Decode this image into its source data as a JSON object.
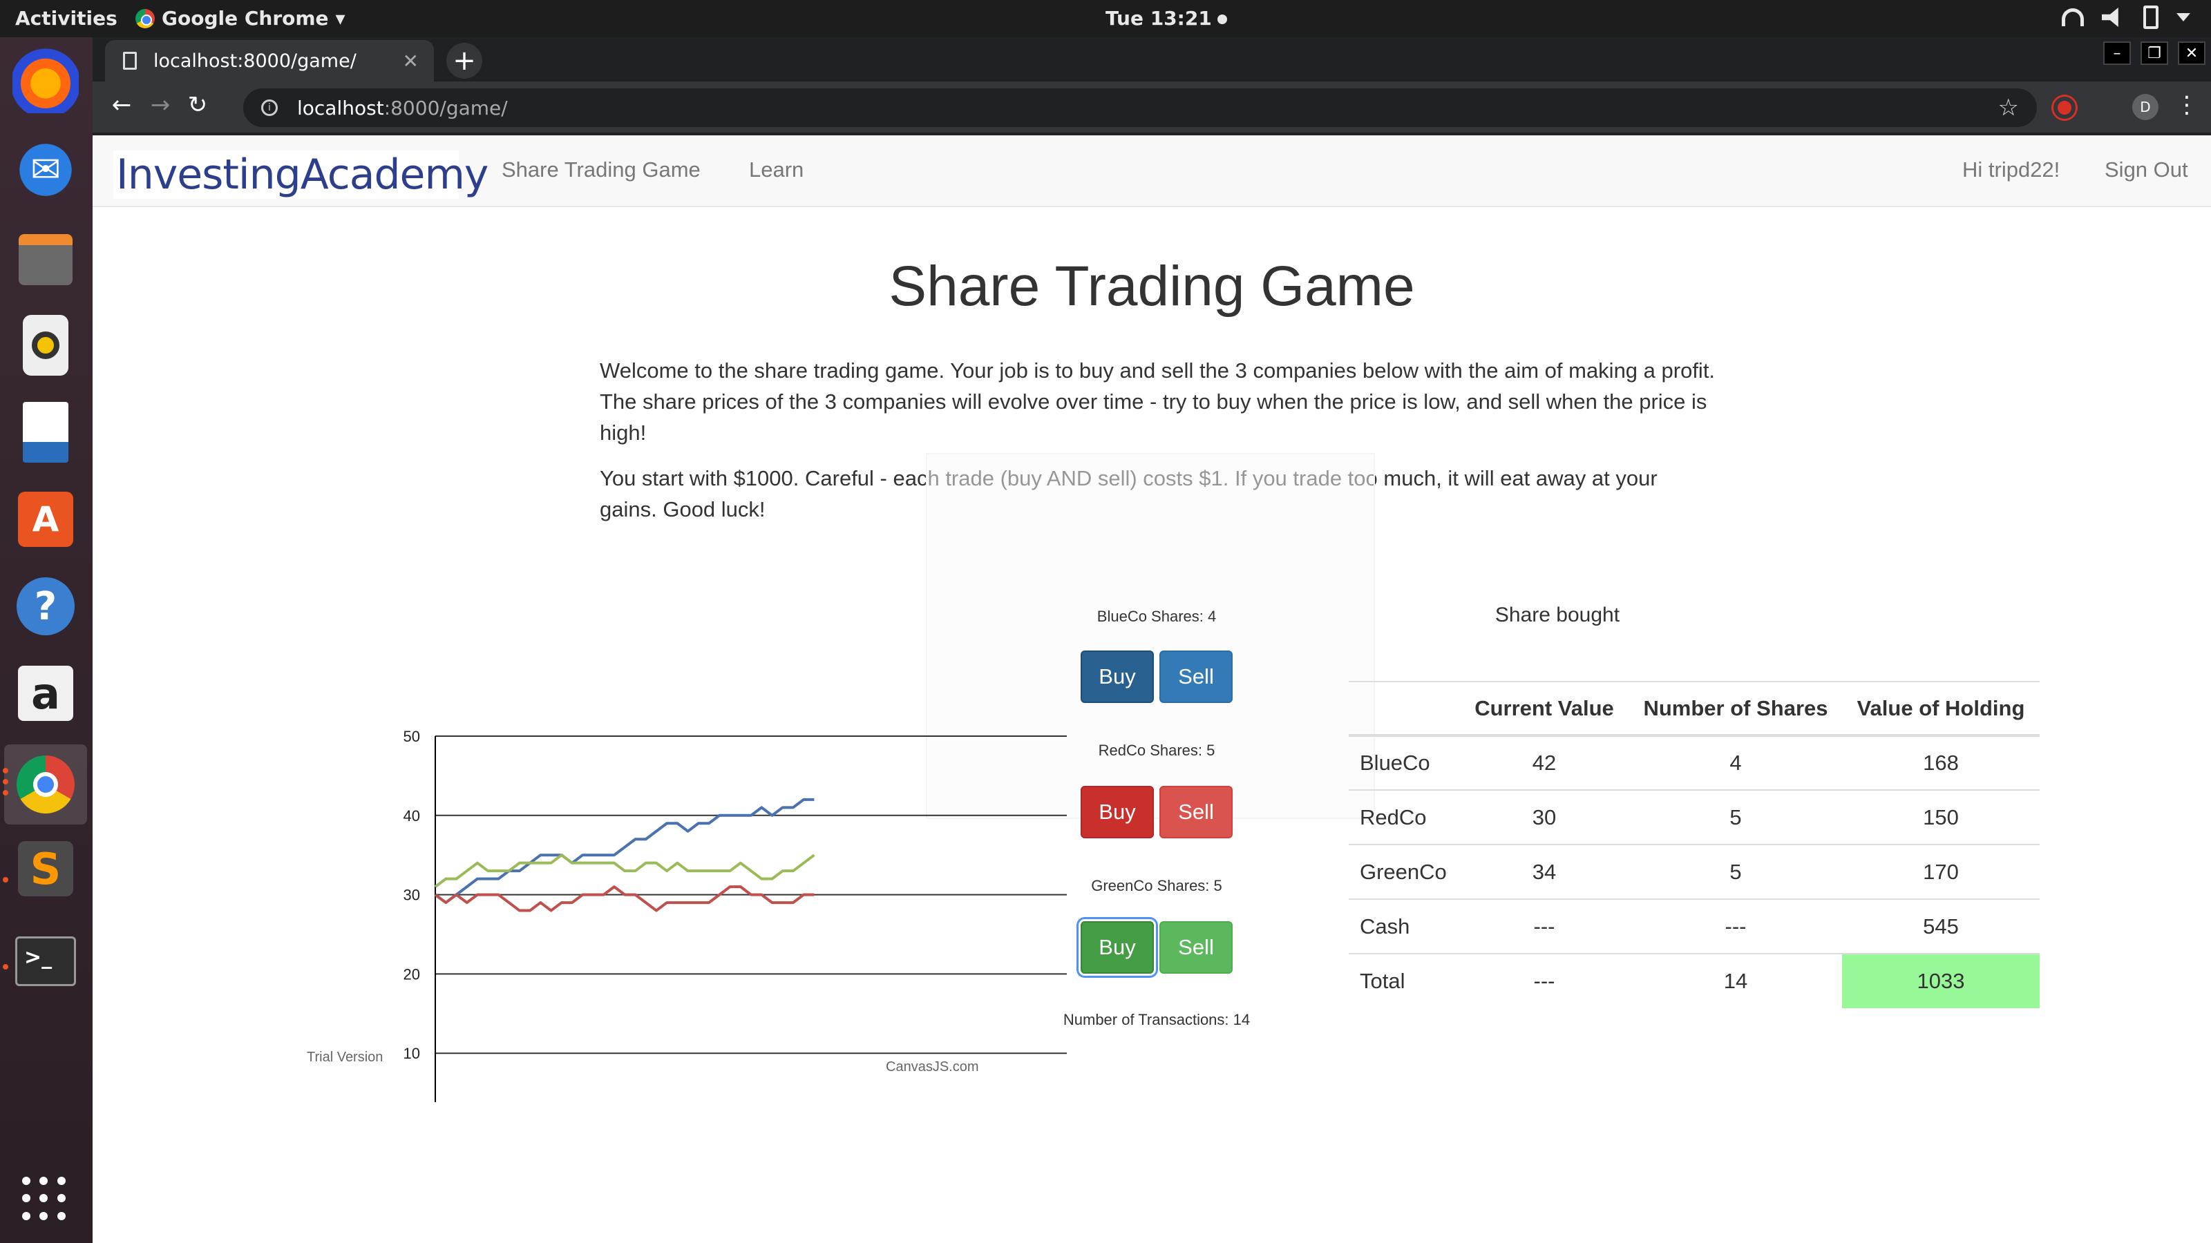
{
  "topbar": {
    "activities": "Activities",
    "app_name": "Google Chrome",
    "clock": "Tue 13:21"
  },
  "dock": {
    "items": [
      "firefox-icon",
      "thunderbird-icon",
      "files-icon",
      "rhythmbox-icon",
      "writer-icon",
      "software-center-icon",
      "help-icon",
      "amazon-icon",
      "chrome-icon",
      "sublime-text-icon",
      "terminal-icon"
    ],
    "amazon_label": "a"
  },
  "browser": {
    "tab_title": "localhost:8000/game/",
    "url_host": "localhost",
    "url_path": ":8000/game/",
    "profile_initial": "D",
    "new_tab": "+"
  },
  "site": {
    "brand": "InvestingAcademy",
    "nav": {
      "game": "Share Trading Game",
      "learn": "Learn",
      "greeting": "Hi tripd22!",
      "signout": "Sign Out"
    }
  },
  "game": {
    "title": "Share Trading Game",
    "intro_1": "Welcome to the share trading game. Your job is to buy and sell the 3 companies below with the aim of making a profit. The share prices of the 3 companies will evolve over time - try to buy when the price is low, and sell when the price is high!",
    "intro_2": "You start with $1000. Careful - each trade (buy AND sell) costs $1. If you trade too much, it will eat away at your gains. Good luck!",
    "controls": {
      "blue_label": "BlueCo Shares: 4",
      "red_label": "RedCo Shares: 5",
      "green_label": "GreenCo Shares: 5",
      "buy": "Buy",
      "sell": "Sell",
      "transactions": "Number of Transactions: 14"
    },
    "table": {
      "caption": "Share bought",
      "headers": [
        "",
        "Current Value",
        "Number of Shares",
        "Value of Holding"
      ],
      "rows": [
        [
          "BlueCo",
          "42",
          "4",
          "168"
        ],
        [
          "RedCo",
          "30",
          "5",
          "150"
        ],
        [
          "GreenCo",
          "34",
          "5",
          "170"
        ],
        [
          "Cash",
          "---",
          "---",
          "545"
        ],
        [
          "Total",
          "---",
          "14",
          "1033"
        ]
      ]
    }
  },
  "chart_footer": {
    "trial": "Trial Version",
    "credit": "CanvasJS.com"
  },
  "chart_data": {
    "type": "line",
    "xlim": [
      0,
      60
    ],
    "ylim": [
      0,
      50
    ],
    "x_ticks": [
      "0",
      "10",
      "20",
      "30",
      "40",
      "50",
      "60"
    ],
    "y_ticks": [
      "0",
      "10",
      "20",
      "30",
      "40",
      "50"
    ],
    "grid": "horizontal",
    "legend_position": "bottom",
    "series": [
      {
        "name": "BlueCo",
        "color": "#4a72b0",
        "x": [
          0,
          1,
          2,
          3,
          4,
          5,
          6,
          7,
          8,
          9,
          10,
          11,
          12,
          13,
          14,
          15,
          16,
          17,
          18,
          19,
          20,
          21,
          22,
          23,
          24,
          25,
          26,
          27,
          28,
          29,
          30,
          31,
          32,
          33,
          34,
          35,
          36
        ],
        "y": [
          30,
          29,
          30,
          31,
          32,
          32,
          32,
          33,
          33,
          34,
          35,
          35,
          35,
          34,
          35,
          35,
          35,
          35,
          36,
          37,
          37,
          38,
          39,
          39,
          38,
          39,
          39,
          40,
          40,
          40,
          40,
          41,
          40,
          41,
          41,
          42,
          42
        ]
      },
      {
        "name": "RedCo",
        "color": "#c0504d",
        "x": [
          0,
          1,
          2,
          3,
          4,
          5,
          6,
          7,
          8,
          9,
          10,
          11,
          12,
          13,
          14,
          15,
          16,
          17,
          18,
          19,
          20,
          21,
          22,
          23,
          24,
          25,
          26,
          27,
          28,
          29,
          30,
          31,
          32,
          33,
          34,
          35,
          36
        ],
        "y": [
          30,
          29,
          30,
          29,
          30,
          30,
          30,
          29,
          28,
          28,
          29,
          28,
          29,
          29,
          30,
          30,
          30,
          31,
          30,
          30,
          29,
          28,
          29,
          29,
          29,
          29,
          29,
          30,
          31,
          31,
          30,
          30,
          29,
          29,
          29,
          30,
          30
        ]
      },
      {
        "name": "GreenCo",
        "color": "#9bbb59",
        "x": [
          0,
          1,
          2,
          3,
          4,
          5,
          6,
          7,
          8,
          9,
          10,
          11,
          12,
          13,
          14,
          15,
          16,
          17,
          18,
          19,
          20,
          21,
          22,
          23,
          24,
          25,
          26,
          27,
          28,
          29,
          30,
          31,
          32,
          33,
          34,
          35,
          36
        ],
        "y": [
          31,
          32,
          32,
          33,
          34,
          33,
          33,
          33,
          34,
          34,
          34,
          34,
          35,
          34,
          34,
          34,
          34,
          34,
          33,
          33,
          34,
          34,
          33,
          34,
          33,
          33,
          33,
          33,
          33,
          34,
          33,
          32,
          32,
          33,
          33,
          34,
          35
        ]
      }
    ]
  }
}
